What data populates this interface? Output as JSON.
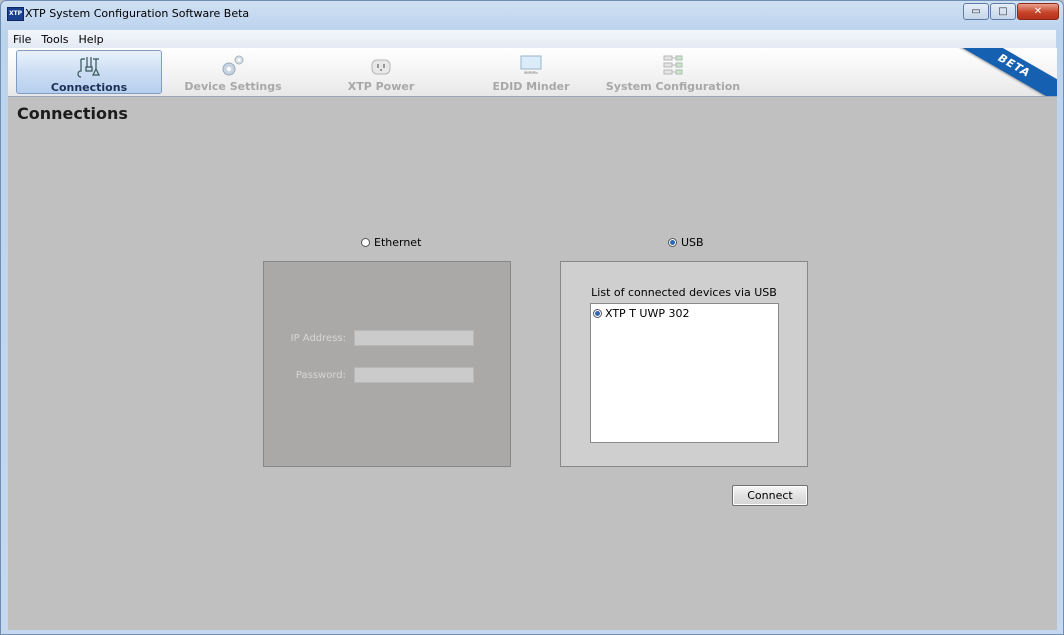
{
  "window": {
    "app_icon_text": "XTP",
    "title": "XTP System Configuration Software Beta",
    "buttons": {
      "minimize": "▭",
      "maximize": "□",
      "close": "✕"
    }
  },
  "menu": [
    "File",
    "Tools",
    "Help"
  ],
  "toolbar": {
    "tabs": [
      {
        "label": "Connections",
        "icon": "connections-icon",
        "active": true
      },
      {
        "label": "Device Settings",
        "icon": "gears-icon",
        "active": false
      },
      {
        "label": "XTP Power",
        "icon": "power-plug-icon",
        "active": false
      },
      {
        "label": "EDID Minder",
        "icon": "monitor-icon",
        "active": false
      },
      {
        "label": "System Configuration",
        "icon": "network-icon",
        "active": false
      }
    ],
    "beta_label": "BETA"
  },
  "page": {
    "title": "Connections"
  },
  "ethernet": {
    "radio_label": "Ethernet",
    "selected": false,
    "ip_label": "IP Address:",
    "ip_value": "",
    "password_label": "Password:",
    "password_value": ""
  },
  "usb": {
    "radio_label": "USB",
    "selected": true,
    "list_caption": "List of connected devices via USB",
    "devices": [
      {
        "name": "XTP T UWP 302",
        "selected": true
      }
    ]
  },
  "connect_button": "Connect",
  "colors": {
    "accent": "#1560b0",
    "background": "#c0c0c0"
  }
}
